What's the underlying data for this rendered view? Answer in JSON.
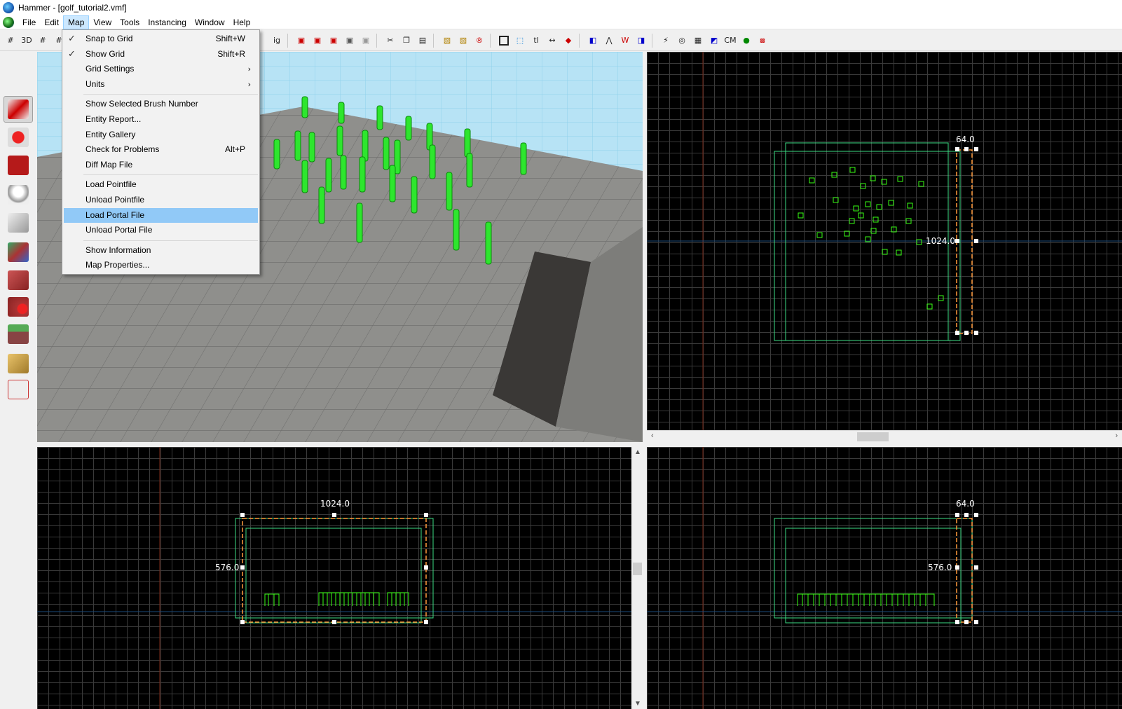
{
  "window": {
    "title": "Hammer - [golf_tutorial2.vmf]"
  },
  "menubar": {
    "items": [
      "File",
      "Edit",
      "Map",
      "View",
      "Tools",
      "Instancing",
      "Window",
      "Help"
    ],
    "active": "Map"
  },
  "toolbar": {
    "text_buttons": [
      "3D",
      "ig",
      "tl",
      "CM"
    ]
  },
  "map_menu": {
    "items": [
      {
        "label": "Snap to Grid",
        "shortcut": "Shift+W",
        "checked": true
      },
      {
        "label": "Show Grid",
        "shortcut": "Shift+R",
        "checked": true
      },
      {
        "label": "Grid Settings",
        "submenu": true
      },
      {
        "label": "Units",
        "submenu": true
      },
      {
        "label": "Show Selected Brush Number"
      },
      {
        "label": "Entity Report..."
      },
      {
        "label": "Entity Gallery"
      },
      {
        "label": "Check for Problems",
        "shortcut": "Alt+P"
      },
      {
        "label": "Diff Map File"
      },
      {
        "label": "Load Pointfile"
      },
      {
        "label": "Unload Pointfile"
      },
      {
        "label": "Load Portal File",
        "highlighted": true
      },
      {
        "label": "Unload Portal File"
      },
      {
        "label": "Show Information"
      },
      {
        "label": "Map Properties..."
      }
    ],
    "check_glyph": "✓",
    "submenu_glyph": "›"
  },
  "views": {
    "top": {
      "label_width": "64.0",
      "label_height": "1024.0"
    },
    "front": {
      "label_width": "1024.0",
      "label_height": "576.0"
    },
    "side": {
      "label_width": "64.0",
      "label_height": "576.0"
    }
  },
  "colors": {
    "selection": "#ff9a3c",
    "brush": "#3ddc84",
    "entity": "#39ff14",
    "grid": "#3a3a3a",
    "menu_hover": "#91c9f7"
  }
}
